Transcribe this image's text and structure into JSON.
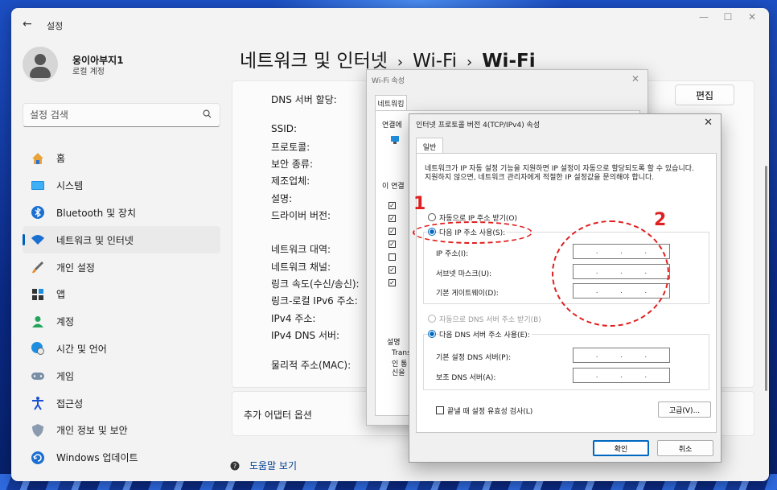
{
  "app": {
    "title": "설정",
    "back_glyph": "←",
    "min_glyph": "—",
    "max_glyph": "☐",
    "close_glyph": "✕"
  },
  "profile": {
    "name": "웅이아부지1",
    "account": "로컬 계정"
  },
  "search": {
    "placeholder": "설정 검색"
  },
  "nav": [
    {
      "label": "홈",
      "icon": "home-icon"
    },
    {
      "label": "시스템",
      "icon": "monitor-icon"
    },
    {
      "label": "Bluetooth 및 장치",
      "icon": "bluetooth-icon"
    },
    {
      "label": "네트워크 및 인터넷",
      "icon": "wifi-icon",
      "active": true
    },
    {
      "label": "개인 설정",
      "icon": "brush-icon"
    },
    {
      "label": "앱",
      "icon": "apps-icon"
    },
    {
      "label": "계정",
      "icon": "person-icon"
    },
    {
      "label": "시간 및 언어",
      "icon": "globe-clock-icon"
    },
    {
      "label": "게임",
      "icon": "gamepad-icon"
    },
    {
      "label": "접근성",
      "icon": "accessibility-icon"
    },
    {
      "label": "개인 정보 및 보안",
      "icon": "shield-icon"
    },
    {
      "label": "Windows 업데이트",
      "icon": "update-icon"
    }
  ],
  "breadcrumb": {
    "part1": "네트워크 및 인터넷",
    "sep": "›",
    "part2": "Wi-Fi",
    "part3": "Wi-Fi"
  },
  "properties": {
    "dns_assignment": "DNS 서버 할당:",
    "edit_label": "편집",
    "labels": [
      "SSID:",
      "프로토콜:",
      "보안 종류:",
      "제조업체:",
      "설명:",
      "드라이버 버전:",
      "네트워크 대역:",
      "네트워크 채널:",
      "링크 속도(수신/송신):",
      "링크-로컬 IPv6 주소:",
      "IPv4 주소:",
      "IPv4 DNS 서버:",
      "물리적 주소(MAC):"
    ]
  },
  "adapter_options": "추가 어댑터 옵션",
  "help": "도움말 보기",
  "wifi_dialog": {
    "title": "Wi-Fi 속성",
    "tab": "네트워킹",
    "connect_label": "연결에",
    "items_label": "이 연결",
    "desc_label": "설명",
    "desc_lines": [
      "Trans",
      "인 통",
      "신을"
    ]
  },
  "ipv4_dialog": {
    "title": "인터넷 프로토콜 버전 4(TCP/IPv4) 속성",
    "close": "✕",
    "tab": "일반",
    "description": "네트워크가 IP 자동 설정 기능을 지원하면 IP 설정이 자동으로 할당되도록 할 수 있습니다. 지원하지 않으면, 네트워크 관리자에게 적절한 IP 설정값을 문의해야 합니다.",
    "auto_ip": "자동으로 IP 주소 받기(O)",
    "manual_ip": "다음 IP 주소 사용(S):",
    "ip_label": "IP 주소(I):",
    "subnet_label": "서브넷 마스크(U):",
    "gateway_label": "기본 게이트웨이(D):",
    "auto_dns": "자동으로 DNS 서버 주소 받기(B)",
    "manual_dns": "다음 DNS 서버 주소 사용(E):",
    "preferred_dns_label": "기본 설정 DNS 서버(P):",
    "alternate_dns_label": "보조 DNS 서버(A):",
    "validate": "끝낼 때 설정 유효성 검사(L)",
    "advanced": "고급(V)...",
    "ok": "확인",
    "cancel": "취소",
    "ip_placeholder": ".   .   ."
  },
  "annotations": {
    "one": "1",
    "two": "2",
    "color": "#e02020"
  },
  "colors": {
    "accent": "#005fb8",
    "dialog_accent": "#0067c0"
  }
}
